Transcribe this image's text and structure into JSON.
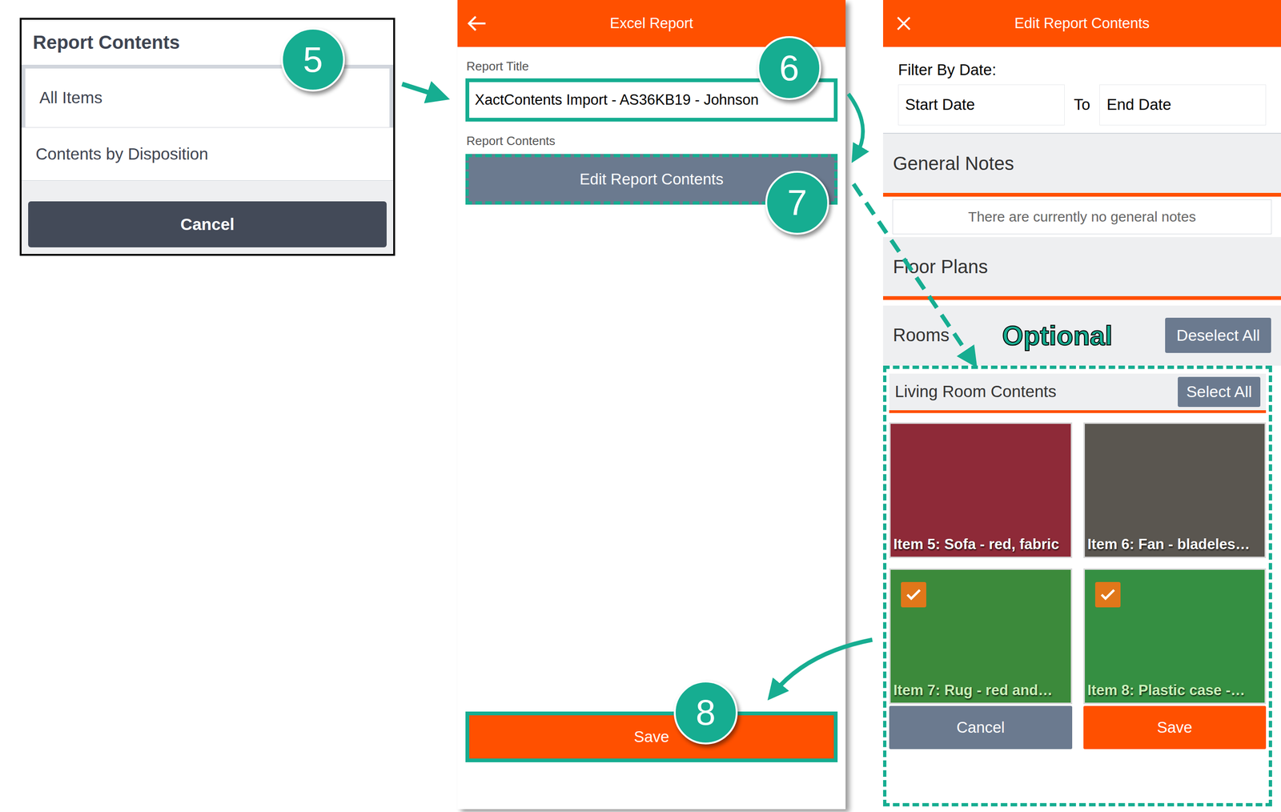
{
  "callouts": [
    "5",
    "6",
    "7",
    "8"
  ],
  "report_contents_menu": {
    "title": "Report Contents",
    "items": [
      {
        "label": "All Items",
        "selected": true
      },
      {
        "label": "Contents by Disposition",
        "selected": false
      }
    ],
    "cancel": "Cancel"
  },
  "excel_report": {
    "title": "Excel Report",
    "report_title_label": "Report Title",
    "report_title_value": "XactContents Import - AS36KB19 - Johnson",
    "report_contents_label": "Report Contents",
    "edit_button": "Edit Report Contents",
    "save": "Save"
  },
  "edit_report_contents": {
    "title": "Edit Report Contents",
    "filter_label": "Filter By Date:",
    "start_placeholder": "Start Date",
    "to": "To",
    "end_placeholder": "End Date",
    "general_notes": "General Notes",
    "general_notes_empty": "There are currently no general notes",
    "floor_plans": "Floor Plans",
    "rooms_label": "Rooms",
    "optional": "Optional",
    "deselect_all": "Deselect All",
    "room": {
      "name": "Living Room Contents",
      "select_all": "Select All",
      "items": [
        {
          "caption": "Item 5: Sofa - red, fabric",
          "selected": false,
          "color": "#8e2a38"
        },
        {
          "caption": "Item 6: Fan - bladeles…",
          "selected": false,
          "color": "#5a5650"
        },
        {
          "caption": "Item 7: Rug - red and…",
          "selected": true,
          "color": "#7a4a3a"
        },
        {
          "caption": "Item 8: Plastic case -…",
          "selected": true,
          "color": "#5e5b55"
        }
      ]
    },
    "cancel": "Cancel",
    "save": "Save"
  }
}
